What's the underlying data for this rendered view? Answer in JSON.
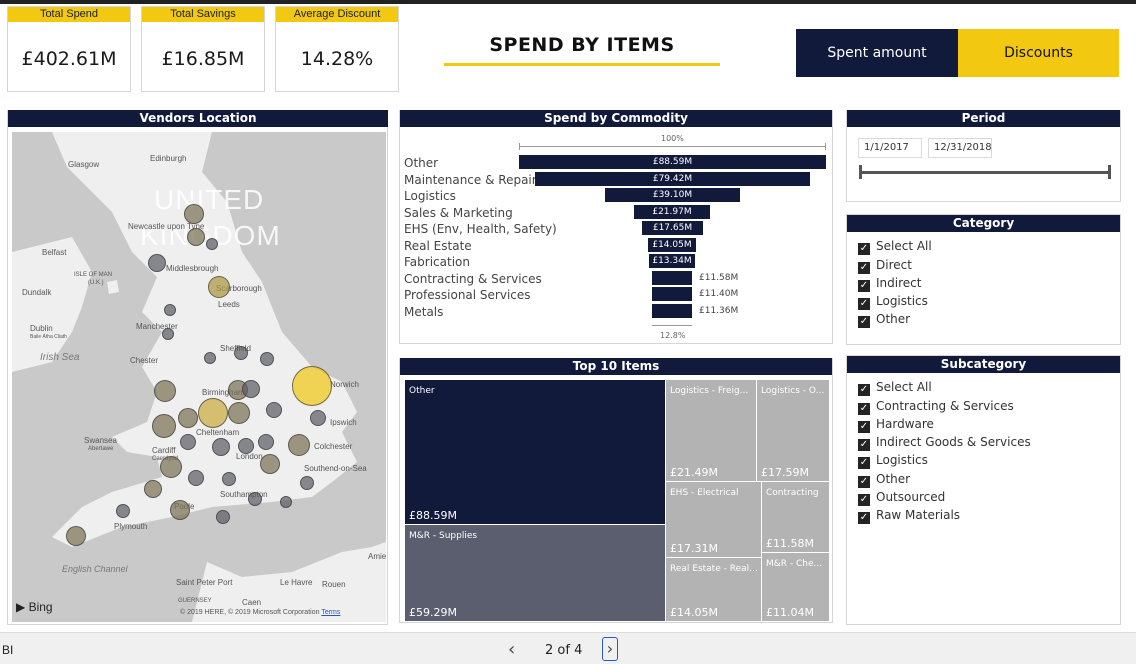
{
  "kpis": [
    {
      "label": "Total Spend",
      "value": "£402.61M"
    },
    {
      "label": "Total Savings",
      "value": "£16.85M"
    },
    {
      "label": "Average Discount",
      "value": "14.28%"
    }
  ],
  "page_title": "SPEND BY ITEMS",
  "buttons": {
    "spent": "Spent amount",
    "discounts": "Discounts"
  },
  "vendors": {
    "title": "Vendors Location",
    "country": [
      "UNITED",
      "KINGDOM"
    ],
    "cities": [
      "Glasgow",
      "Edinburgh",
      "Newcastle upon Tyne",
      "Belfast",
      "ISLE OF MAN",
      "(U.K.)",
      "Middlesbrough",
      "Dundalk",
      "Scarborough",
      "Leeds",
      "Dublin",
      "Baile Átha Cliath",
      "Manchester",
      "Irish Sea",
      "Sheffield",
      "Chester",
      "Birmingham",
      "Norwich",
      "Ipswich",
      "Swansea",
      "Abertawe",
      "Cardiff",
      "Caerdydd",
      "Cheltenham",
      "London",
      "Colchester",
      "Southend-on-Sea",
      "Southampton",
      "Poole",
      "Plymouth",
      "English Channel",
      "Saint Peter Port",
      "GUERNSEY",
      "Le Havre",
      "Rouen",
      "Caen",
      "Amiens"
    ],
    "bing": "Bing",
    "copyright": "© 2019 HERE, © 2019 Microsoft Corporation",
    "terms": "Terms"
  },
  "commodity": {
    "title": "Spend by Commodity",
    "top_pct": "100%",
    "bottom_pct": "12.8%",
    "items": [
      {
        "label": "Other",
        "value": "£88.59M"
      },
      {
        "label": "Maintenance & Repair",
        "value": "£79.42M"
      },
      {
        "label": "Logistics",
        "value": "£39.10M"
      },
      {
        "label": "Sales & Marketing",
        "value": "£21.97M"
      },
      {
        "label": "EHS (Env, Health, Safety)",
        "value": "£17.65M"
      },
      {
        "label": "Real Estate",
        "value": "£14.05M"
      },
      {
        "label": "Fabrication",
        "value": "£13.34M"
      },
      {
        "label": "Contracting & Services",
        "value": "£11.58M"
      },
      {
        "label": "Professional Services",
        "value": "£11.40M"
      },
      {
        "label": "Metals",
        "value": "£11.36M"
      }
    ]
  },
  "top10": {
    "title": "Top 10 Items",
    "tiles": [
      {
        "label": "Other",
        "value": "£88.59M"
      },
      {
        "label": "M&R - Supplies",
        "value": "£59.29M"
      },
      {
        "label": "Logistics - Freig...",
        "value": "£21.49M"
      },
      {
        "label": "Logistics - O...",
        "value": "£17.59M"
      },
      {
        "label": "EHS - Electrical",
        "value": "£17.31M"
      },
      {
        "label": "Contracting",
        "value": "£11.58M"
      },
      {
        "label": "Real Estate - Real...",
        "value": "£14.05M"
      },
      {
        "label": "M&R - Che...",
        "value": "£11.04M"
      }
    ]
  },
  "period": {
    "title": "Period",
    "start": "1/1/2017",
    "end": "12/31/2018"
  },
  "category": {
    "title": "Category",
    "options": [
      "Select All",
      "Direct",
      "Indirect",
      "Logistics",
      "Other"
    ]
  },
  "subcategory": {
    "title": "Subcategory",
    "options": [
      "Select All",
      "Contracting & Services",
      "Hardware",
      "Indirect Goods & Services",
      "Logistics",
      "Other",
      "Outsourced",
      "Raw Materials"
    ]
  },
  "footer": {
    "app": "BI",
    "page": "2 of 4"
  },
  "colors": {
    "navy": "#111a3a",
    "yellow": "#f2c811"
  }
}
